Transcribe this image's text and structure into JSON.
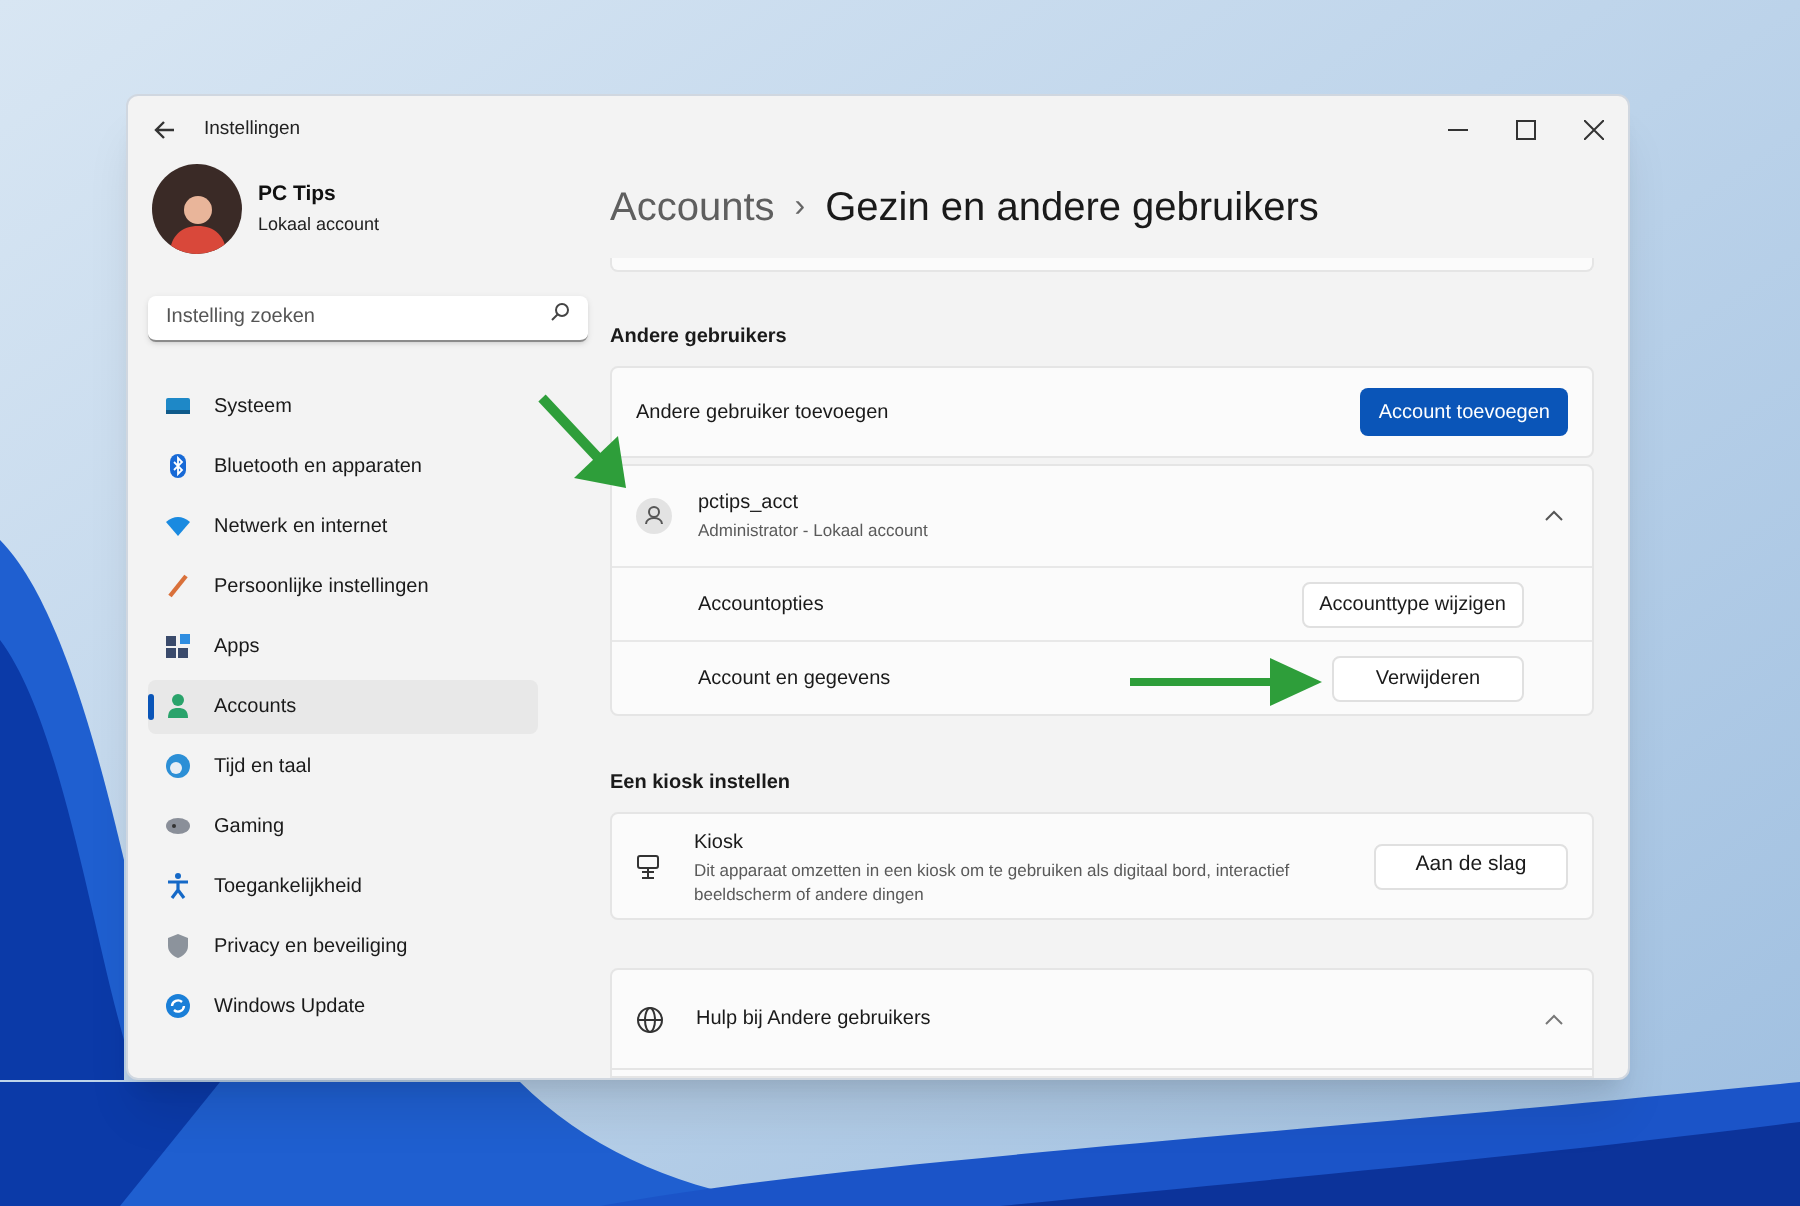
{
  "window": {
    "title": "Instellingen"
  },
  "profile": {
    "name": "PC Tips",
    "subtitle": "Lokaal account"
  },
  "search": {
    "placeholder": "Instelling zoeken"
  },
  "sidebar": {
    "items": [
      {
        "label": "Systeem",
        "selected": false
      },
      {
        "label": "Bluetooth en apparaten",
        "selected": false
      },
      {
        "label": "Netwerk en internet",
        "selected": false
      },
      {
        "label": "Persoonlijke instellingen",
        "selected": false
      },
      {
        "label": "Apps",
        "selected": false
      },
      {
        "label": "Accounts",
        "selected": true
      },
      {
        "label": "Tijd en taal",
        "selected": false
      },
      {
        "label": "Gaming",
        "selected": false
      },
      {
        "label": "Toegankelijkheid",
        "selected": false
      },
      {
        "label": "Privacy en beveiliging",
        "selected": false
      },
      {
        "label": "Windows Update",
        "selected": false
      }
    ]
  },
  "breadcrumb": {
    "parent": "Accounts",
    "separator": "›",
    "current": "Gezin en andere gebruikers"
  },
  "other_users": {
    "heading": "Andere gebruikers",
    "add_row": {
      "label": "Andere gebruiker toevoegen",
      "button": "Account toevoegen"
    },
    "user": {
      "name": "pctips_acct",
      "subtitle": "Administrator - Lokaal account",
      "expanded": true,
      "rows": [
        {
          "label": "Accountopties",
          "button": "Accounttype wijzigen"
        },
        {
          "label": "Account en gegevens",
          "button": "Verwijderen"
        }
      ]
    }
  },
  "kiosk": {
    "heading": "Een kiosk instellen",
    "title": "Kiosk",
    "description": "Dit apparaat omzetten in een kiosk om te gebruiken als digitaal bord, interactief beeldscherm of andere dingen",
    "button": "Aan de slag"
  },
  "help": {
    "title": "Hulp bij Andere gebruikers",
    "expanded": true
  }
}
